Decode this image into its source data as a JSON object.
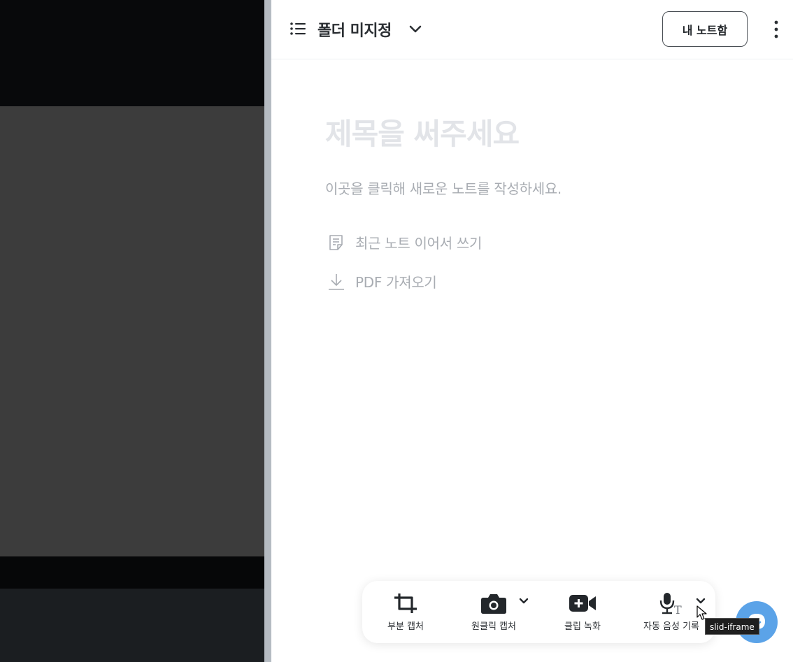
{
  "header": {
    "folder_title": "폴더 미지정",
    "my_notes_button": "내 노트함"
  },
  "editor": {
    "title_placeholder": "제목을 써주세요",
    "body_placeholder": "이곳을 클릭해 새로운 노트를 작성하세요.",
    "actions": [
      {
        "label": "최근 노트 이어서 쓰기",
        "icon": "note-icon"
      },
      {
        "label": "PDF 가져오기",
        "icon": "download-icon"
      }
    ]
  },
  "toolbar": {
    "items": [
      {
        "label": "부분 캡처",
        "icon": "crop-icon"
      },
      {
        "label": "원클릭 캡처",
        "icon": "camera-icon"
      },
      {
        "label": "클립 녹화",
        "icon": "video-plus-icon"
      },
      {
        "label": "자동 음성 기록",
        "icon": "mic-text-icon"
      }
    ]
  },
  "tooltip": "slid-iframe",
  "colors": {
    "accent_blue": "#5ba3e8",
    "left_dark": "#1b1d20",
    "left_mid": "#3c3c3c",
    "splitter": "#b5bbc2"
  }
}
